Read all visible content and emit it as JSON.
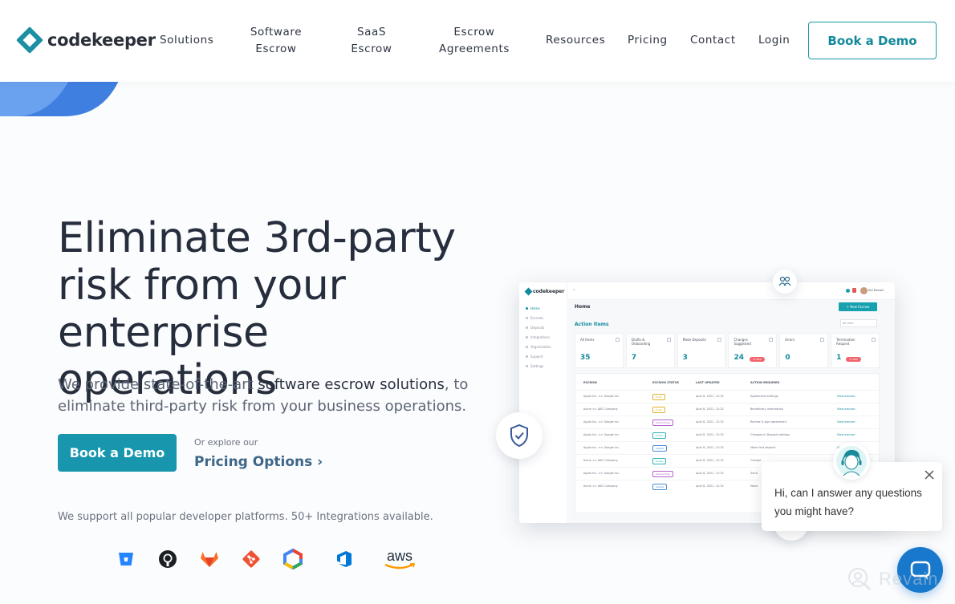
{
  "header": {
    "logo_text": "codekeeper",
    "nav": [
      {
        "label": "Solutions"
      },
      {
        "label": "Software\nEscrow"
      },
      {
        "label": "SaaS\nEscrow"
      },
      {
        "label": "Escrow\nAgreements"
      },
      {
        "label": "Resources"
      },
      {
        "label": "Pricing"
      },
      {
        "label": "Contact"
      },
      {
        "label": "Login"
      }
    ],
    "cta_label": "Book a Demo"
  },
  "hero": {
    "title": "Eliminate 3rd-party risk from your enterprise operations",
    "subtitle_prefix": "We provide state-of-the-art ",
    "subtitle_emphasis": "software escrow solutions",
    "subtitle_suffix": ", to eliminate third-party risk from your business operations.",
    "primary_cta": "Book a Demo",
    "explore_label": "Or explore our",
    "pricing_link": "Pricing Options ›",
    "integrations_text": "We support all popular developer platforms. 50+ Integrations available.",
    "platforms": [
      {
        "name": "bitbucket-icon",
        "color": "#2684ff"
      },
      {
        "name": "github-icon",
        "color": "#1b1f23"
      },
      {
        "name": "gitlab-icon",
        "color": "#fc6d26"
      },
      {
        "name": "git-icon",
        "color": "#f05133"
      },
      {
        "name": "google-cloud-icon",
        "color": "#4285f4"
      },
      {
        "name": "azure-devops-icon",
        "color": "#0078d7"
      },
      {
        "name": "aws-icon",
        "color": "#232f3e",
        "label": "aws"
      }
    ]
  },
  "dashboard": {
    "logo_text": "codekeeper",
    "user_name": "Ted Russell",
    "page_title": "Home",
    "new_button": "+ New Escrow",
    "section_title": "Action Items",
    "filter_label": "All time",
    "sidebar": [
      "Home",
      "Escrows",
      "Deposits",
      "Integrations",
      "Organization",
      "Support",
      "Settings"
    ],
    "cards": [
      {
        "label": "All Items",
        "value": "35",
        "badge": ""
      },
      {
        "label": "Drafts & Onboarding",
        "value": "7",
        "badge": ""
      },
      {
        "label": "Make Deposits",
        "value": "3",
        "badge": ""
      },
      {
        "label": "Changes Suggested",
        "value": "24",
        "badge": "4 new"
      },
      {
        "label": "Errors",
        "value": "0",
        "badge": ""
      },
      {
        "label": "Termination Request",
        "value": "1",
        "badge": "1 new"
      }
    ],
    "columns": [
      "ESCROW",
      "ESCROW STATUS",
      "LAST UPDATED",
      "ACTION REQUIRED",
      ""
    ],
    "rows": [
      {
        "escrow": "Apple Inc. <> Google Inc.",
        "status": "Draft",
        "status_color": "#e0b32c",
        "updated": "April 8, 2021, 12:32",
        "action": "Agreement settings",
        "link": "View escrow ›"
      },
      {
        "escrow": "Acme <> ABC Company",
        "status": "Draft",
        "status_color": "#e0b32c",
        "updated": "April 8, 2021, 12:32",
        "action": "Beneficiary information",
        "link": "View escrow ›"
      },
      {
        "escrow": "Apple Inc. <> Google Inc.",
        "status": "Onboarding",
        "status_color": "#b463c9",
        "updated": "April 8, 2021, 12:32",
        "action": "Review & sign agreement",
        "link": "View escrow ›"
      },
      {
        "escrow": "Apple Inc. <> Google Inc.",
        "status": "Active",
        "status_color": "#2db3b8",
        "updated": "April 8, 2021, 12:32",
        "action": "Changes in Deposit settings",
        "link": "View escrow ›"
      },
      {
        "escrow": "Apple Inc. <> Google Inc.",
        "status": "Signed",
        "status_color": "#4a8fd8",
        "updated": "April 8, 2021, 12:32",
        "action": "Make first deposit",
        "link": "View escrow ›"
      },
      {
        "escrow": "Acme <> ABC Company",
        "status": "Active",
        "status_color": "#2db3b8",
        "updated": "April 8, 2021, 12:32",
        "action": "Change",
        "link": ""
      },
      {
        "escrow": "Apple Inc. <> Google Inc.",
        "status": "Onboarding",
        "status_color": "#b463c9",
        "updated": "April 8, 2021, 12:32",
        "action": "Send",
        "link": ""
      },
      {
        "escrow": "Acme <> ABC Company",
        "status": "Signed",
        "status_color": "#4a8fd8",
        "updated": "April 8, 2021, 12:32",
        "action": "Make",
        "link": ""
      }
    ]
  },
  "chat": {
    "message": "Hi, can I answer any questions you might have?"
  },
  "watermark": "Revain",
  "colors": {
    "brand": "#1796ad",
    "heading": "#262d3c",
    "link": "#3d6688",
    "chat": "#1778cc"
  }
}
